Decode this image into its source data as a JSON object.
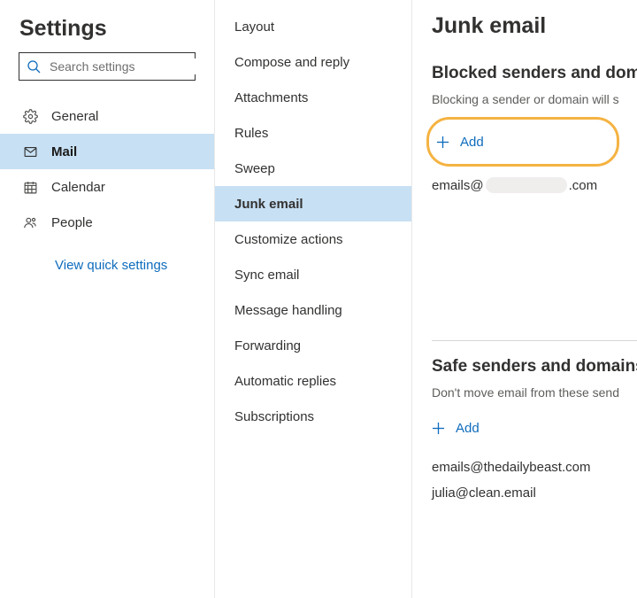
{
  "settings": {
    "title": "Settings",
    "searchPlaceholder": "Search settings",
    "nav": [
      {
        "key": "general",
        "label": "General"
      },
      {
        "key": "mail",
        "label": "Mail"
      },
      {
        "key": "calendar",
        "label": "Calendar"
      },
      {
        "key": "people",
        "label": "People"
      }
    ],
    "quickLink": "View quick settings"
  },
  "mailNav": [
    {
      "key": "layout",
      "label": "Layout"
    },
    {
      "key": "compose",
      "label": "Compose and reply"
    },
    {
      "key": "attachments",
      "label": "Attachments"
    },
    {
      "key": "rules",
      "label": "Rules"
    },
    {
      "key": "sweep",
      "label": "Sweep"
    },
    {
      "key": "junk",
      "label": "Junk email"
    },
    {
      "key": "customize",
      "label": "Customize actions"
    },
    {
      "key": "sync",
      "label": "Sync email"
    },
    {
      "key": "message",
      "label": "Message handling"
    },
    {
      "key": "forwarding",
      "label": "Forwarding"
    },
    {
      "key": "autoreply",
      "label": "Automatic replies"
    },
    {
      "key": "subs",
      "label": "Subscriptions"
    }
  ],
  "junk": {
    "title": "Junk email",
    "blocked": {
      "heading": "Blocked senders and domains",
      "description": "Blocking a sender or domain will s",
      "addLabel": "Add",
      "entries": [
        {
          "prefix": "emails@",
          "suffix": ".com",
          "redacted": true
        }
      ]
    },
    "safe": {
      "heading": "Safe senders and domains",
      "description": "Don't move email from these send",
      "addLabel": "Add",
      "entries": [
        {
          "text": "emails@thedailybeast.com"
        },
        {
          "text": "julia@clean.email"
        }
      ]
    }
  }
}
